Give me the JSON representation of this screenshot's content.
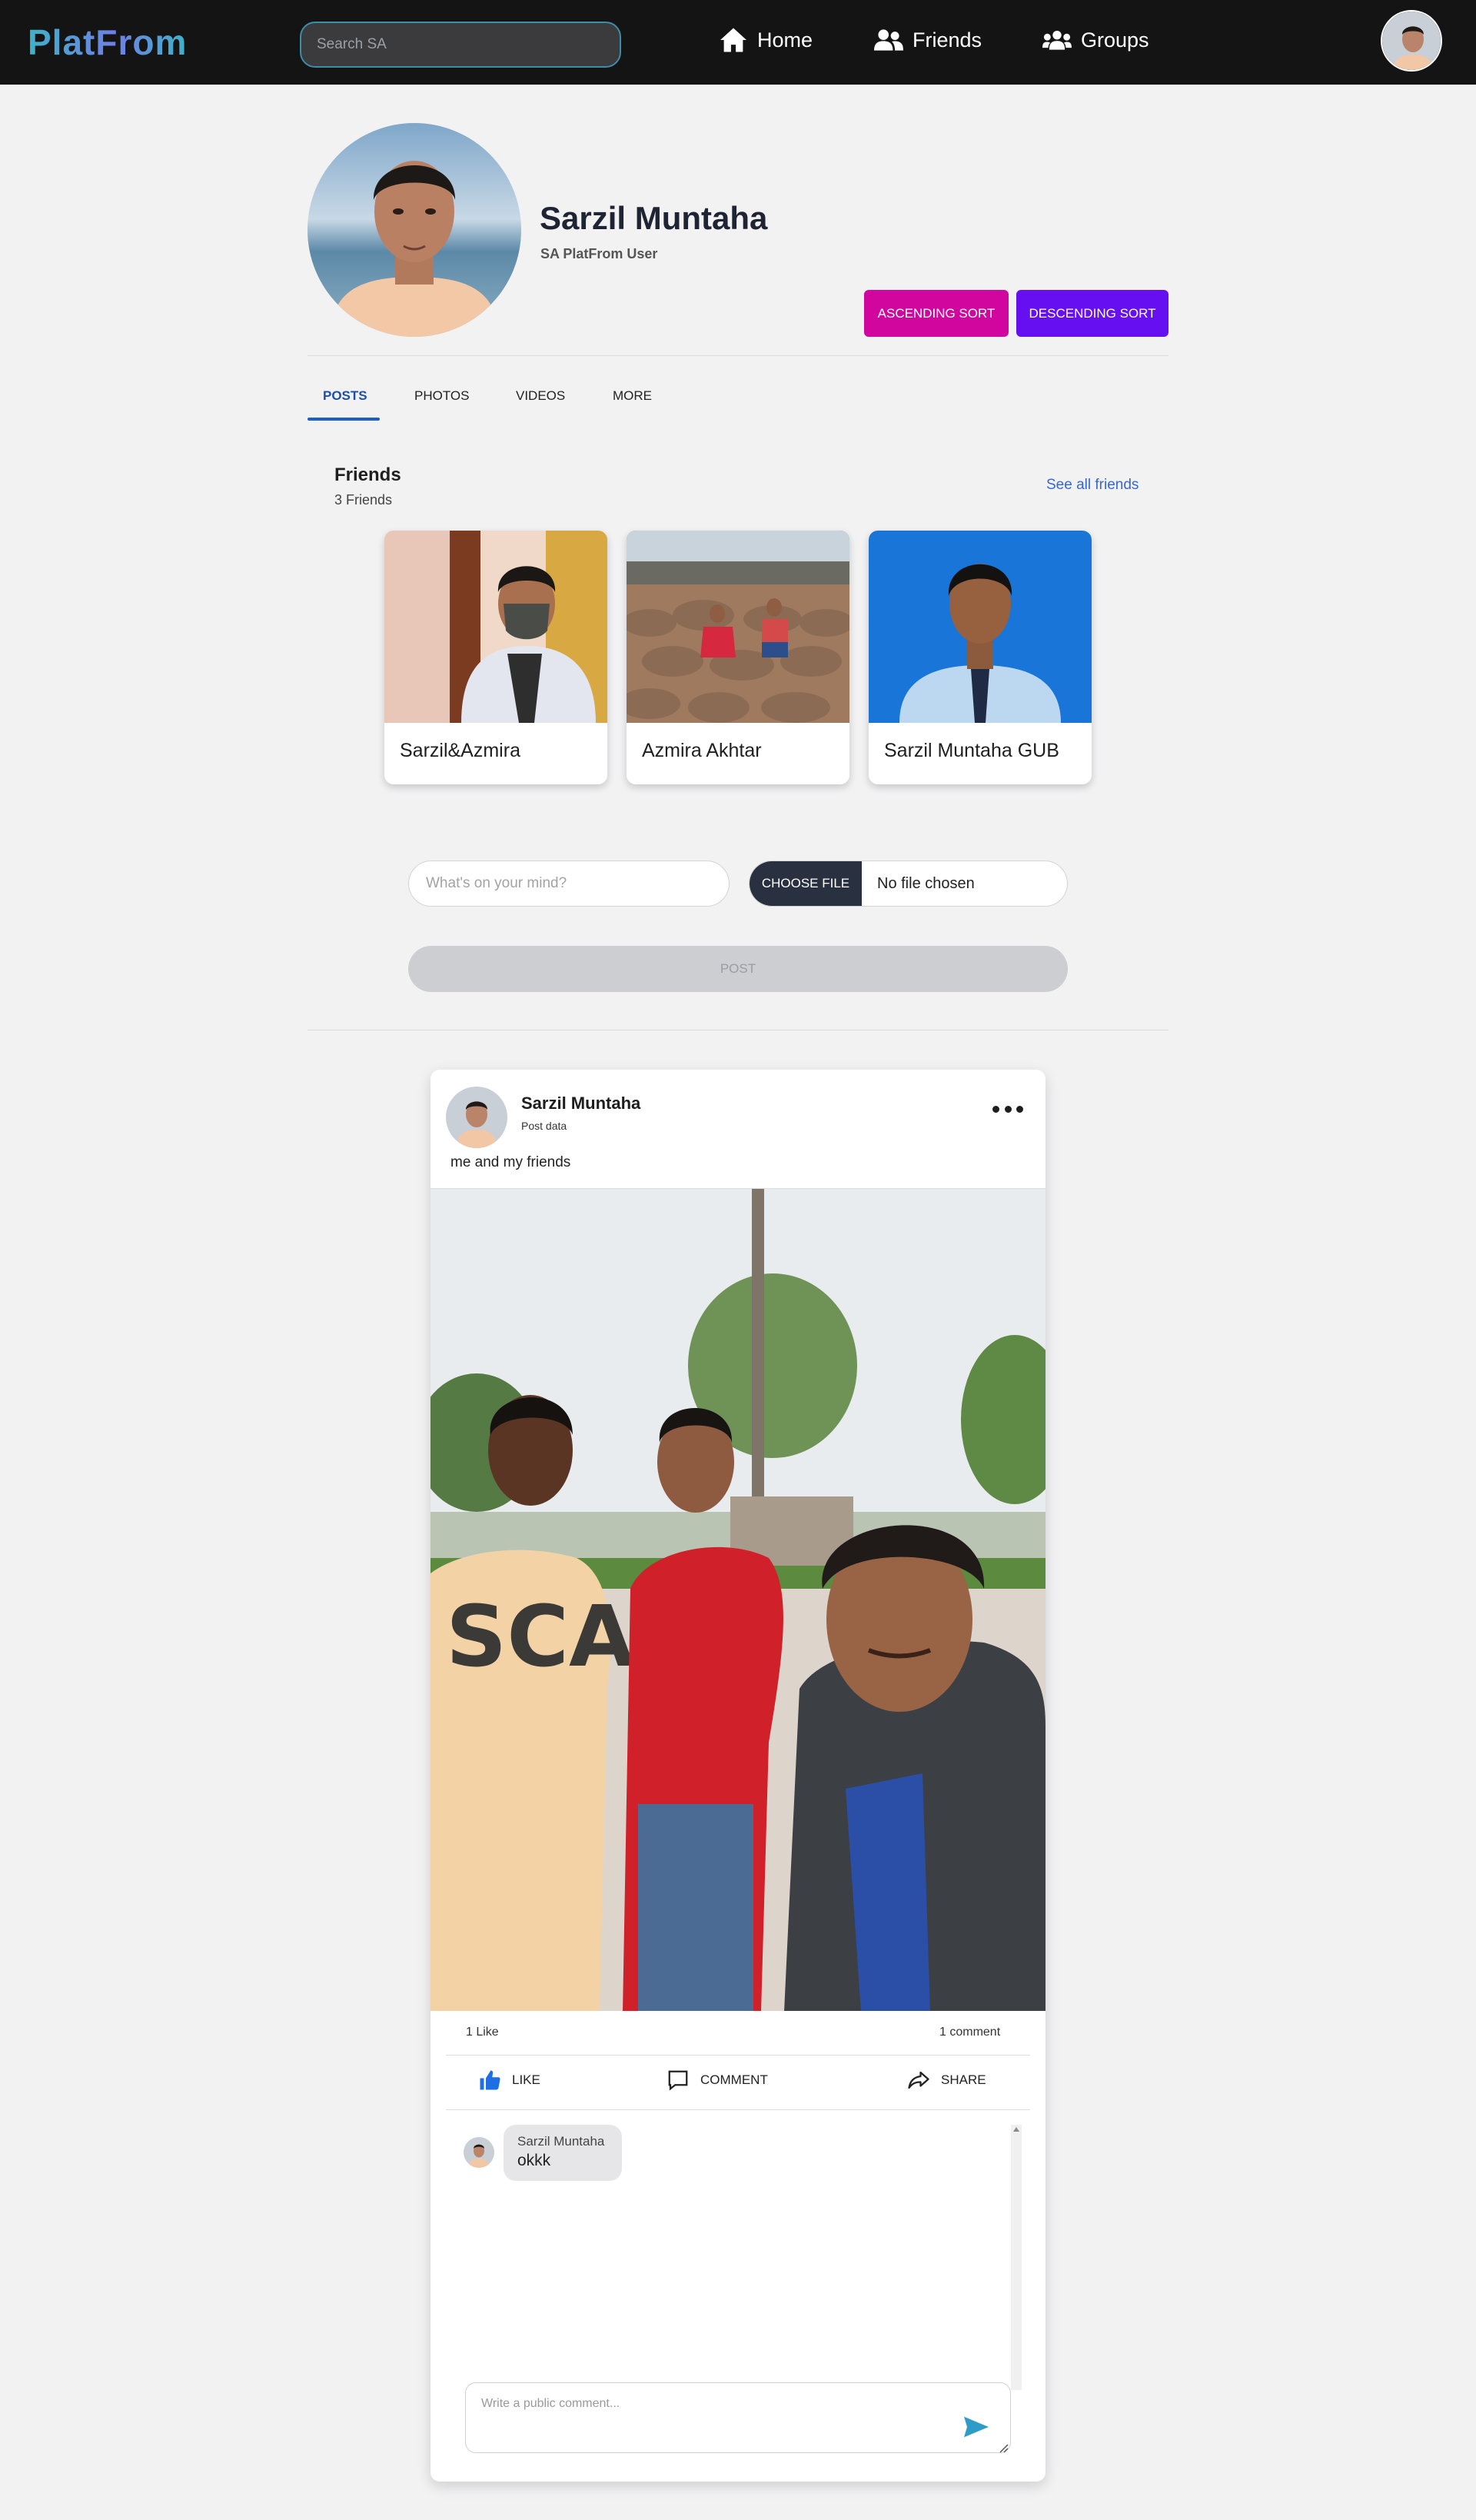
{
  "navbar": {
    "logo": "PlatFrom",
    "search_placeholder": "Search SA",
    "items": [
      {
        "label": "Home",
        "icon": "home-icon"
      },
      {
        "label": "Friends",
        "icon": "friends-icon"
      },
      {
        "label": "Groups",
        "icon": "groups-icon"
      }
    ]
  },
  "profile": {
    "name": "Sarzil Muntaha",
    "subtitle": "SA PlatFrom User",
    "ascending_label": "ASCENDING SORT",
    "descending_label": "DESCENDING SORT"
  },
  "tabs": [
    {
      "label": "POSTS",
      "active": true
    },
    {
      "label": "PHOTOS",
      "active": false
    },
    {
      "label": "VIDEOS",
      "active": false
    },
    {
      "label": "MORE",
      "active": false
    }
  ],
  "friends": {
    "title": "Friends",
    "count": "3 Friends",
    "see_all": "See all friends",
    "list": [
      {
        "name": "Sarzil&Azmira"
      },
      {
        "name": "Azmira Akhtar"
      },
      {
        "name": "Sarzil Muntaha GUB"
      }
    ]
  },
  "composer": {
    "placeholder": "What's on your mind?",
    "choose_file": "CHOOSE FILE",
    "file_status": "No file chosen",
    "post_label": "POST"
  },
  "post": {
    "author": "Sarzil Muntaha",
    "meta": "Post data",
    "text": "me and my friends",
    "likes": "1 Like",
    "comments_count": "1 comment",
    "actions": {
      "like": "LIKE",
      "comment": "COMMENT",
      "share": "SHARE"
    },
    "comments": [
      {
        "author": "Sarzil Muntaha",
        "text": "okkk"
      }
    ],
    "comment_placeholder": "Write a public comment..."
  },
  "colors": {
    "navbar_bg": "#141414",
    "ascending_btn": "#d1069f",
    "descending_btn": "#6610f2",
    "link": "#3568d4",
    "active_tab": "#1e4fa8",
    "like_icon": "#1d6fe3",
    "send_icon": "#2f9cc8"
  }
}
